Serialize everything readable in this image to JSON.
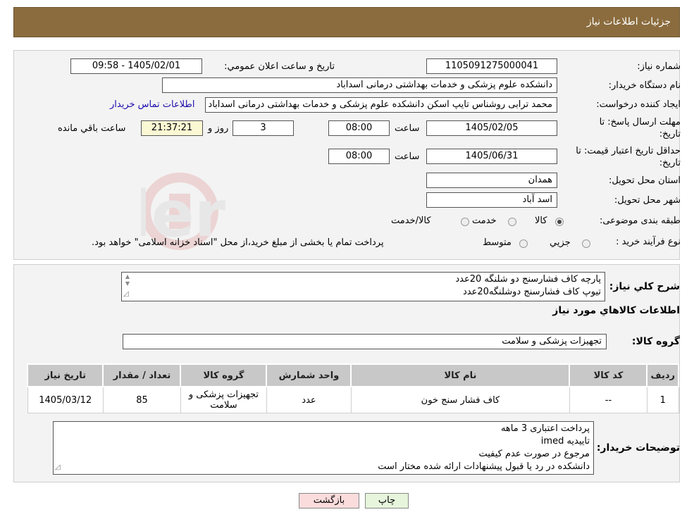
{
  "header": {
    "title": "جزئیات اطلاعات نیاز"
  },
  "form": {
    "need_number": {
      "label": "شماره نیاز:",
      "value": "1105091275000041"
    },
    "announce_datetime": {
      "label": "تاریخ و ساعت اعلان عمومي:",
      "value": "1405/02/01 - 09:58"
    },
    "buyer_org": {
      "label": "نام دستگاه خريدار:",
      "value": "دانشکده علوم پزشکی و خدمات بهداشتی درمانی اسداباد"
    },
    "requester": {
      "label": "ايجاد کننده درخواست:",
      "value": "محمد ترابی روشناس تایپ اسکن دانشکده علوم پزشکی و خدمات بهداشتی درمانی اسداباد",
      "contact_link": "اطلاعات تماس خريدار"
    },
    "reply_deadline": {
      "label_line1": "مهلت ارسال پاسخ: تا",
      "label_line2": "تاريخ:",
      "date": "1405/02/05",
      "time_label": "ساعت",
      "time": "08:00",
      "days": "3",
      "days_label": "روز و",
      "remaining": "21:37:21",
      "remaining_label": "ساعت باقي مانده"
    },
    "price_validity": {
      "label_line1": "حداقل تاريخ اعتبار قيمت: تا",
      "label_line2": "تاريخ:",
      "date": "1405/06/31",
      "time_label": "ساعت",
      "time": "08:00"
    },
    "province": {
      "label": "استان محل تحويل:",
      "value": "همدان"
    },
    "city": {
      "label": "شهر محل تحويل:",
      "value": "اسد آباد"
    },
    "category": {
      "label": "طبقه بندی موضوعی:",
      "options": [
        "کالا",
        "خدمت",
        "کالا/خدمت"
      ],
      "selected": 0
    },
    "purchase_type": {
      "label": "نوع فرآیند خرید :",
      "options": [
        "جزيي",
        "متوسط"
      ],
      "note": "پرداخت تمام یا بخشی از مبلغ خرید،از محل \"اسناد خزانه اسلامی\" خواهد بود."
    }
  },
  "summary": {
    "label": "شرح کلي نياز:",
    "lines": [
      "پارچه کاف فشارسنج دو شلنگه 20عدد",
      "تیوپ کاف فشارسنج دوشلنگه20عدد"
    ]
  },
  "goods": {
    "section_title": "اطلاعات کالاهاي مورد نياز",
    "group_label": "گروه کالا:",
    "group_value": "تجهیزات پزشکی و سلامت",
    "columns": [
      "رديف",
      "کد کالا",
      "نام کالا",
      "واحد شمارش",
      "گروه کالا",
      "تعداد / مقدار",
      "تاريخ نياز"
    ],
    "rows": [
      {
        "row": "1",
        "code": "--",
        "name": "کاف فشار سنج خون",
        "unit": "عدد",
        "group": "تجهیزات پزشکی و سلامت",
        "qty": "85",
        "date": "1405/03/12"
      }
    ]
  },
  "buyer_notes": {
    "label": "توضيحات خريدار:",
    "lines": [
      "پرداخت اعتباری 3 ماهه",
      "تاییدیه imed",
      "مرجوع در صورت عدم کیفیت",
      "دانشکده در رد یا قبول پیشنهادات ارائه شده مختار است"
    ]
  },
  "buttons": {
    "print": "چاپ",
    "back": "بازگشت"
  },
  "colors": {
    "header": "#8b6c3e",
    "print_button": "#e6f5dc",
    "back_button": "#fbdcdc",
    "timer": "#fbf8d4"
  }
}
